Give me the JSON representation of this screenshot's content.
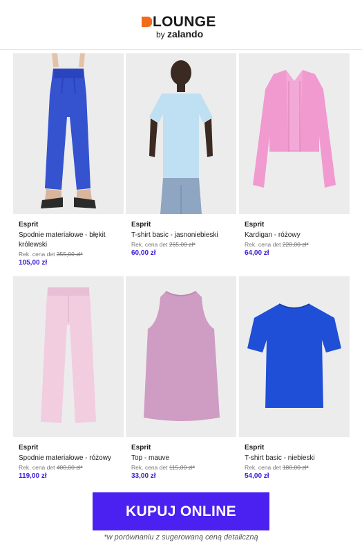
{
  "header": {
    "logo_word": "LOUNGE",
    "logo_by": "by",
    "logo_brand": "zalando",
    "accent": "#f26b1d"
  },
  "products": [
    {
      "brand": "Esprit",
      "name": "Spodnie materiałowe - błękit królewski",
      "rek_label": "Rek. cena det",
      "old_price": "355,00 zł*",
      "price": "105,00 zł",
      "image": "blue-wide-trousers"
    },
    {
      "brand": "Esprit",
      "name": "T-shirt basic - jasnoniebieski",
      "rek_label": "Rek. cena det",
      "old_price": "265,00 zł*",
      "price": "60,00 zł",
      "image": "light-blue-tshirt"
    },
    {
      "brand": "Esprit",
      "name": "Kardigan - różowy",
      "rek_label": "Rek. cena det",
      "old_price": "220,00 zł*",
      "price": "64,00 zł",
      "image": "pink-cardigan"
    },
    {
      "brand": "Esprit",
      "name": "Spodnie materiałowe - różowy",
      "rek_label": "Rek. cena det",
      "old_price": "400,00 zł*",
      "price": "119,00 zł",
      "image": "pink-trousers"
    },
    {
      "brand": "Esprit",
      "name": "Top - mauve",
      "rek_label": "Rek. cena det",
      "old_price": "115,00 zł*",
      "price": "33,00 zł",
      "image": "mauve-top"
    },
    {
      "brand": "Esprit",
      "name": "T-shirt basic - niebieski",
      "rek_label": "Rek. cena det",
      "old_price": "180,00 zł*",
      "price": "54,00 zł",
      "image": "blue-tshirt"
    }
  ],
  "cta": {
    "label": "KUPUJ ONLINE",
    "color": "#4a21f0"
  },
  "footnote": "*w porównaniu z sugerowaną ceną detaliczną",
  "colors": {
    "price": "#3a1fd6"
  }
}
